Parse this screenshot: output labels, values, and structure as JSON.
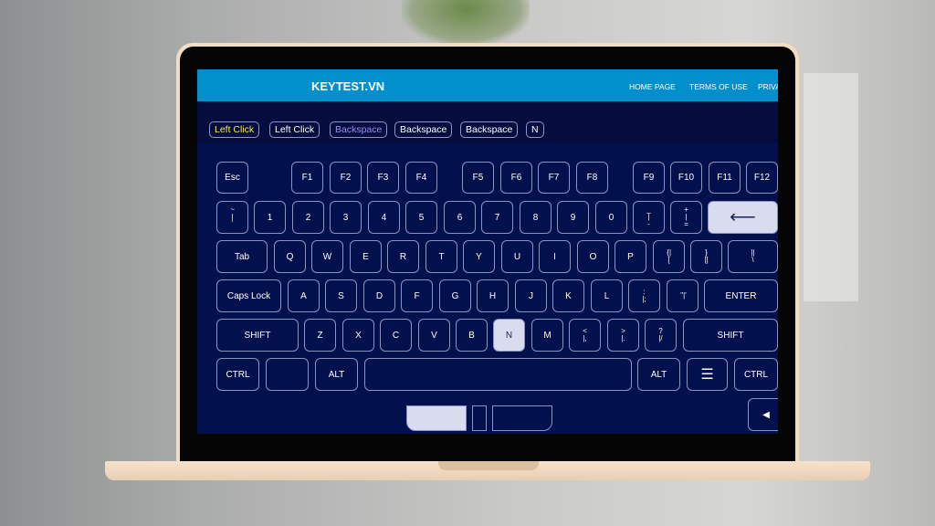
{
  "site": {
    "logo": "KEYTEST.VN",
    "nav": [
      "HOME PAGE",
      "TERMS OF USE",
      "PRIVA"
    ]
  },
  "history": [
    {
      "label": "Left Click",
      "color": "#f2e85a"
    },
    {
      "label": "Left Click",
      "color": "#ffffff"
    },
    {
      "label": "Backspace",
      "color": "#9c8cf0"
    },
    {
      "label": "Backspace",
      "color": "#ffffff"
    },
    {
      "label": "Backspace",
      "color": "#ffffff"
    },
    {
      "label": "N",
      "color": "#ffffff"
    }
  ],
  "keyboard": {
    "rows": [
      [
        "Esc",
        "F1",
        "F2",
        "F3",
        "F4",
        "F5",
        "F6",
        "F7",
        "F8",
        "F9",
        "F10",
        "F11",
        "F12"
      ],
      [
        "~|`",
        "1",
        "2",
        "3",
        "4",
        "5",
        "6",
        "7",
        "8",
        "9",
        "0",
        "_|-",
        "+|=",
        "⟵"
      ],
      [
        "Tab",
        "Q",
        "W",
        "E",
        "R",
        "T",
        "Y",
        "U",
        "I",
        "O",
        "P",
        "{|[",
        "}|]",
        "||\\"
      ],
      [
        "Caps Lock",
        "A",
        "S",
        "D",
        "F",
        "G",
        "H",
        "J",
        "K",
        "L",
        ":|;",
        "\"|'",
        "ENTER"
      ],
      [
        "SHIFT",
        "Z",
        "X",
        "C",
        "V",
        "B",
        "N",
        "M",
        "<|,",
        ">|.",
        "?|/",
        "SHIFT"
      ],
      [
        "CTRL",
        "",
        "ALT",
        "",
        "ALT",
        "☰",
        "CTRL"
      ]
    ],
    "active_keys": [
      "⟵",
      "N"
    ],
    "arrow_label": "◀"
  },
  "mouse": {
    "left_button_pressed": true
  },
  "colors": {
    "header": "#0290cc",
    "background": "#03104e",
    "active_key": "#d9dcef"
  }
}
